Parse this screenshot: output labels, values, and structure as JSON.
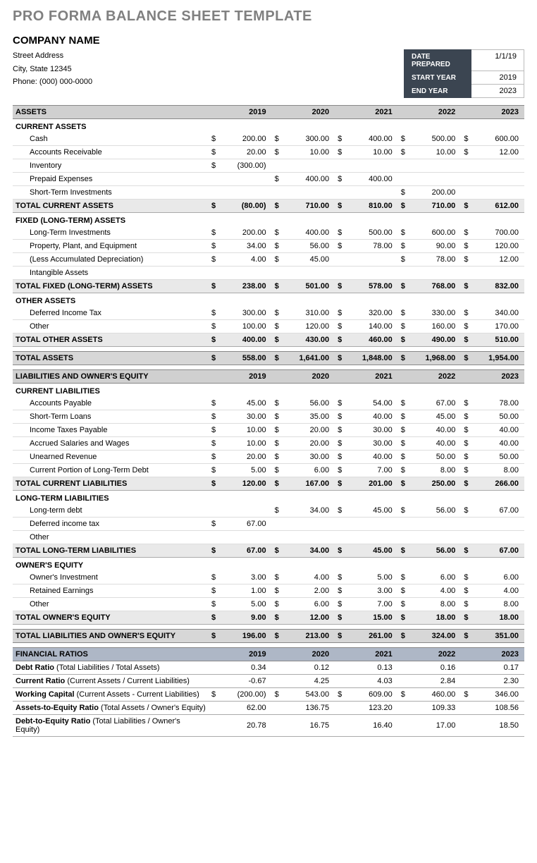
{
  "template_title": "PRO FORMA BALANCE SHEET TEMPLATE",
  "company_name": "COMPANY NAME",
  "address": {
    "street": "Street Address",
    "citystate": "City, State  12345",
    "phone": "Phone: (000) 000-0000"
  },
  "meta": {
    "date_prepared_label": "DATE PREPARED",
    "date_prepared": "1/1/19",
    "start_year_label": "START YEAR",
    "start_year": "2019",
    "end_year_label": "END YEAR",
    "end_year": "2023"
  },
  "years": [
    "2019",
    "2020",
    "2021",
    "2022",
    "2023"
  ],
  "sections": {
    "assets_header": "ASSETS",
    "current_assets": {
      "title": "CURRENT ASSETS",
      "rows": [
        {
          "label": "Cash",
          "vals": [
            "200.00",
            "300.00",
            "400.00",
            "500.00",
            "600.00"
          ],
          "cur": [
            "$",
            "$",
            "$",
            "$",
            "$"
          ]
        },
        {
          "label": "Accounts Receivable",
          "vals": [
            "20.00",
            "10.00",
            "10.00",
            "10.00",
            "12.00"
          ],
          "cur": [
            "$",
            "$",
            "$",
            "$",
            "$"
          ]
        },
        {
          "label": "Inventory",
          "vals": [
            "(300.00)",
            "",
            "",
            "",
            ""
          ],
          "cur": [
            "$",
            "",
            "",
            "",
            ""
          ]
        },
        {
          "label": "Prepaid Expenses",
          "vals": [
            "",
            "400.00",
            "400.00",
            "",
            ""
          ],
          "cur": [
            "",
            "$",
            "$",
            "",
            ""
          ]
        },
        {
          "label": "Short-Term Investments",
          "vals": [
            "",
            "",
            "",
            "200.00",
            ""
          ],
          "cur": [
            "",
            "",
            "",
            "$",
            ""
          ]
        }
      ],
      "total": {
        "label": "TOTAL CURRENT ASSETS",
        "vals": [
          "(80.00)",
          "710.00",
          "810.00",
          "710.00",
          "612.00"
        ],
        "cur": [
          "$",
          "$",
          "$",
          "$",
          "$"
        ]
      }
    },
    "fixed_assets": {
      "title": "FIXED (LONG-TERM) ASSETS",
      "rows": [
        {
          "label": "Long-Term Investments",
          "vals": [
            "200.00",
            "400.00",
            "500.00",
            "600.00",
            "700.00"
          ],
          "cur": [
            "$",
            "$",
            "$",
            "$",
            "$"
          ]
        },
        {
          "label": "Property, Plant, and Equipment",
          "vals": [
            "34.00",
            "56.00",
            "78.00",
            "90.00",
            "120.00"
          ],
          "cur": [
            "$",
            "$",
            "$",
            "$",
            "$"
          ]
        },
        {
          "label": "(Less Accumulated Depreciation)",
          "vals": [
            "4.00",
            "45.00",
            "",
            "78.00",
            "12.00"
          ],
          "cur": [
            "$",
            "$",
            "",
            "$",
            "$"
          ]
        },
        {
          "label": "Intangible Assets",
          "vals": [
            "",
            "",
            "",
            "",
            ""
          ],
          "cur": [
            "",
            "",
            "",
            "",
            ""
          ]
        }
      ],
      "total": {
        "label": "TOTAL FIXED (LONG-TERM) ASSETS",
        "vals": [
          "238.00",
          "501.00",
          "578.00",
          "768.00",
          "832.00"
        ],
        "cur": [
          "$",
          "$",
          "$",
          "$",
          "$"
        ]
      }
    },
    "other_assets": {
      "title": "OTHER ASSETS",
      "rows": [
        {
          "label": "Deferred Income Tax",
          "vals": [
            "300.00",
            "310.00",
            "320.00",
            "330.00",
            "340.00"
          ],
          "cur": [
            "$",
            "$",
            "$",
            "$",
            "$"
          ]
        },
        {
          "label": "Other",
          "vals": [
            "100.00",
            "120.00",
            "140.00",
            "160.00",
            "170.00"
          ],
          "cur": [
            "$",
            "$",
            "$",
            "$",
            "$"
          ]
        }
      ],
      "total": {
        "label": "TOTAL OTHER ASSETS",
        "vals": [
          "400.00",
          "430.00",
          "460.00",
          "490.00",
          "510.00"
        ],
        "cur": [
          "$",
          "$",
          "$",
          "$",
          "$"
        ]
      }
    },
    "total_assets": {
      "label": "TOTAL ASSETS",
      "vals": [
        "558.00",
        "1,641.00",
        "1,848.00",
        "1,968.00",
        "1,954.00"
      ],
      "cur": [
        "$",
        "$",
        "$",
        "$",
        "$"
      ]
    },
    "liab_header": "LIABILITIES AND OWNER'S EQUITY",
    "current_liab": {
      "title": "CURRENT LIABILITIES",
      "rows": [
        {
          "label": "Accounts Payable",
          "vals": [
            "45.00",
            "56.00",
            "54.00",
            "67.00",
            "78.00"
          ],
          "cur": [
            "$",
            "$",
            "$",
            "$",
            "$"
          ]
        },
        {
          "label": "Short-Term Loans",
          "vals": [
            "30.00",
            "35.00",
            "40.00",
            "45.00",
            "50.00"
          ],
          "cur": [
            "$",
            "$",
            "$",
            "$",
            "$"
          ]
        },
        {
          "label": "Income Taxes Payable",
          "vals": [
            "10.00",
            "20.00",
            "30.00",
            "40.00",
            "40.00"
          ],
          "cur": [
            "$",
            "$",
            "$",
            "$",
            "$"
          ]
        },
        {
          "label": "Accrued Salaries and Wages",
          "vals": [
            "10.00",
            "20.00",
            "30.00",
            "40.00",
            "40.00"
          ],
          "cur": [
            "$",
            "$",
            "$",
            "$",
            "$"
          ]
        },
        {
          "label": "Unearned Revenue",
          "vals": [
            "20.00",
            "30.00",
            "40.00",
            "50.00",
            "50.00"
          ],
          "cur": [
            "$",
            "$",
            "$",
            "$",
            "$"
          ]
        },
        {
          "label": "Current Portion of Long-Term Debt",
          "vals": [
            "5.00",
            "6.00",
            "7.00",
            "8.00",
            "8.00"
          ],
          "cur": [
            "$",
            "$",
            "$",
            "$",
            "$"
          ]
        }
      ],
      "total": {
        "label": "TOTAL CURRENT LIABILITIES",
        "vals": [
          "120.00",
          "167.00",
          "201.00",
          "250.00",
          "266.00"
        ],
        "cur": [
          "$",
          "$",
          "$",
          "$",
          "$"
        ]
      }
    },
    "longterm_liab": {
      "title": "LONG-TERM LIABILITIES",
      "rows": [
        {
          "label": "Long-term debt",
          "vals": [
            "",
            "34.00",
            "45.00",
            "56.00",
            "67.00"
          ],
          "cur": [
            "",
            "$",
            "$",
            "$",
            "$"
          ]
        },
        {
          "label": "Deferred income tax",
          "vals": [
            "67.00",
            "",
            "",
            "",
            ""
          ],
          "cur": [
            "$",
            "",
            "",
            "",
            ""
          ]
        },
        {
          "label": "Other",
          "vals": [
            "",
            "",
            "",
            "",
            ""
          ],
          "cur": [
            "",
            "",
            "",
            "",
            ""
          ]
        }
      ],
      "total": {
        "label": "TOTAL LONG-TERM LIABILITIES",
        "vals": [
          "67.00",
          "34.00",
          "45.00",
          "56.00",
          "67.00"
        ],
        "cur": [
          "$",
          "$",
          "$",
          "$",
          "$"
        ]
      }
    },
    "owners_equity": {
      "title": "OWNER'S EQUITY",
      "rows": [
        {
          "label": "Owner's Investment",
          "vals": [
            "3.00",
            "4.00",
            "5.00",
            "6.00",
            "6.00"
          ],
          "cur": [
            "$",
            "$",
            "$",
            "$",
            "$"
          ]
        },
        {
          "label": "Retained Earnings",
          "vals": [
            "1.00",
            "2.00",
            "3.00",
            "4.00",
            "4.00"
          ],
          "cur": [
            "$",
            "$",
            "$",
            "$",
            "$"
          ]
        },
        {
          "label": "Other",
          "vals": [
            "5.00",
            "6.00",
            "7.00",
            "8.00",
            "8.00"
          ],
          "cur": [
            "$",
            "$",
            "$",
            "$",
            "$"
          ]
        }
      ],
      "total": {
        "label": "TOTAL OWNER'S EQUITY",
        "vals": [
          "9.00",
          "12.00",
          "15.00",
          "18.00",
          "18.00"
        ],
        "cur": [
          "$",
          "$",
          "$",
          "$",
          "$"
        ]
      }
    },
    "total_liab_equity": {
      "label": "TOTAL LIABILITIES AND OWNER'S EQUITY",
      "vals": [
        "196.00",
        "213.00",
        "261.00",
        "324.00",
        "351.00"
      ],
      "cur": [
        "$",
        "$",
        "$",
        "$",
        "$"
      ]
    },
    "ratios_header": "FINANCIAL RATIOS",
    "ratios": [
      {
        "label": "Debt Ratio",
        "desc": " (Total Liabilities / Total Assets)",
        "vals": [
          "0.34",
          "0.12",
          "0.13",
          "0.16",
          "0.17"
        ],
        "cur": [
          "",
          "",
          "",
          "",
          ""
        ]
      },
      {
        "label": "Current Ratio",
        "desc": " (Current Assets / Current Liabilities)",
        "vals": [
          "-0.67",
          "4.25",
          "4.03",
          "2.84",
          "2.30"
        ],
        "cur": [
          "",
          "",
          "",
          "",
          ""
        ]
      },
      {
        "label": "Working Capital",
        "desc": " (Current Assets - Current Liabilities)",
        "vals": [
          "(200.00)",
          "543.00",
          "609.00",
          "460.00",
          "346.00"
        ],
        "cur": [
          "$",
          "$",
          "$",
          "$",
          "$"
        ]
      },
      {
        "label": "Assets-to-Equity Ratio",
        "desc": " (Total Assets / Owner's Equity)",
        "vals": [
          "62.00",
          "136.75",
          "123.20",
          "109.33",
          "108.56"
        ],
        "cur": [
          "",
          "",
          "",
          "",
          ""
        ]
      },
      {
        "label": "Debt-to-Equity Ratio",
        "desc": " (Total Liabilities / Owner's Equity)",
        "vals": [
          "20.78",
          "16.75",
          "16.40",
          "17.00",
          "18.50"
        ],
        "cur": [
          "",
          "",
          "",
          "",
          ""
        ]
      }
    ]
  }
}
